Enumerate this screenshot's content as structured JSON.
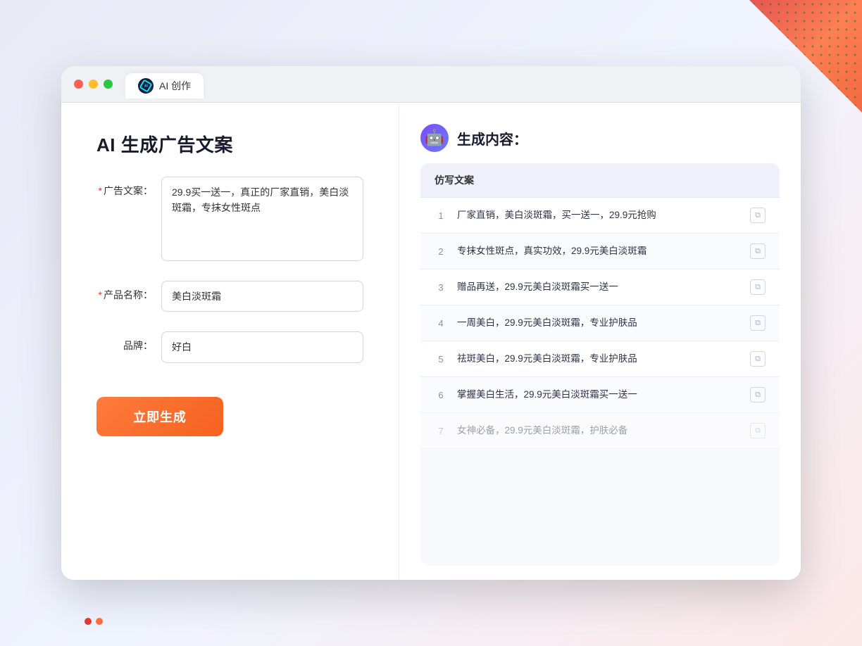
{
  "window": {
    "tab_label": "AI 创作"
  },
  "left_panel": {
    "page_title": "AI 生成广告文案",
    "fields": [
      {
        "id": "ad_copy",
        "label": "广告文案：",
        "required": true,
        "type": "textarea",
        "value": "29.9买一送一，真正的厂家直销，美白淡斑霜，专抹女性斑点",
        "placeholder": ""
      },
      {
        "id": "product_name",
        "label": "产品名称：",
        "required": true,
        "type": "input",
        "value": "美白淡斑霜",
        "placeholder": ""
      },
      {
        "id": "brand",
        "label": "品牌：",
        "required": false,
        "type": "input",
        "value": "好白",
        "placeholder": ""
      }
    ],
    "generate_btn_label": "立即生成"
  },
  "right_panel": {
    "title": "生成内容：",
    "results_header": "仿写文案",
    "results": [
      {
        "num": "1",
        "text": "厂家直销，美白淡斑霜，买一送一，29.9元抢购",
        "faded": false
      },
      {
        "num": "2",
        "text": "专抹女性斑点，真实功效，29.9元美白淡斑霜",
        "faded": false
      },
      {
        "num": "3",
        "text": "赠品再送，29.9元美白淡斑霜买一送一",
        "faded": false
      },
      {
        "num": "4",
        "text": "一周美白，29.9元美白淡斑霜，专业护肤品",
        "faded": false
      },
      {
        "num": "5",
        "text": "祛斑美白，29.9元美白淡斑霜，专业护肤品",
        "faded": false
      },
      {
        "num": "6",
        "text": "掌握美白生活，29.9元美白淡斑霜买一送一",
        "faded": false
      },
      {
        "num": "7",
        "text": "女神必备，29.9元美白淡斑霜，护肤必备",
        "faded": true
      }
    ]
  },
  "colors": {
    "accent": "#ff7b3d",
    "primary": "#6979f8",
    "required": "#e53935"
  }
}
